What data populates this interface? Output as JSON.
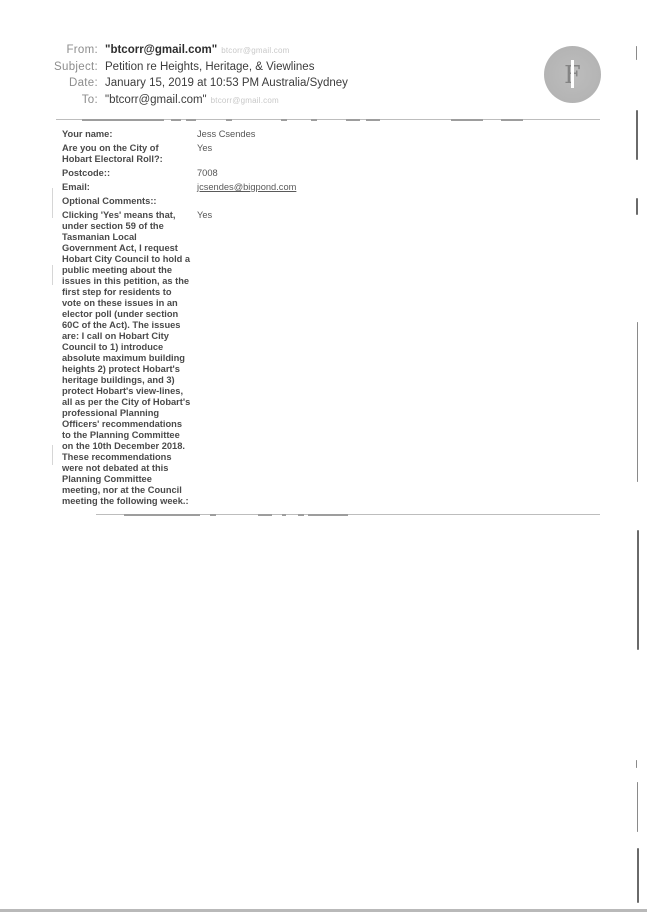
{
  "email": {
    "header": {
      "from_label": "From:",
      "from_value": "\"btcorr@gmail.com\"",
      "from_faint": "btcorr@gmail.com",
      "subject_label": "Subject:",
      "subject_value": "Petition re Heights, Heritage, & Viewlines",
      "date_label": "Date:",
      "date_value": "January 15, 2019 at 10:53 PM Australia/Sydney",
      "to_label": "To:",
      "to_value": "\"btcorr@gmail.com\"",
      "to_faint": "btcorr@gmail.com"
    },
    "avatar": {
      "icon": "sender-avatar-icon",
      "glyph": "F"
    }
  },
  "form": {
    "rows": [
      {
        "label": "Your name:",
        "value": "Jess Csendes"
      },
      {
        "label": "Are you on the City of Hobart Electoral Roll?:",
        "value": "Yes"
      },
      {
        "label": "Postcode::",
        "value": "7008"
      },
      {
        "label": "Email:",
        "value": "jcsendes@bigpond.com"
      },
      {
        "label": "Optional Comments::",
        "value": ""
      },
      {
        "label": "Clicking 'Yes' means that, under section 59 of the Tasmanian Local Government Act, I request Hobart City Council to hold a public meeting about the issues in this petition, as the first step for residents to vote on these issues in an elector poll (under section 60C of the Act). The issues are: I call on Hobart City Council to 1) introduce absolute maximum building heights 2) protect Hobart's heritage buildings, and 3) protect Hobart's view-lines, all as per the City of Hobart's professional Planning Officers' recommendations to the Planning Committee on the 10th December 2018. These recommendations were not debated at this Planning Committee meeting, nor at the Council meeting the following week.:",
        "value": "Yes"
      }
    ],
    "long_label_lines": [
      "Clicking 'Yes' means that,",
      "under section 59 of the",
      "Tasmanian Local",
      "Government Act, I request",
      "Hobart City Council to hold a",
      "public meeting about the",
      "issues in this petition, as the",
      "first step for residents to",
      "vote on these issues in an",
      "elector poll (under section",
      "60C of the Act). The issues",
      "are: I call on Hobart City",
      "Council to 1) introduce",
      "absolute maximum building",
      "heights 2) protect Hobart's",
      "heritage buildings, and 3)",
      "protect Hobart's view-lines,",
      "all as per the City of Hobart's",
      "professional Planning",
      "Officers' recommendations",
      "to the Planning Committee",
      "on the 10th December 2018.",
      "These recommendations",
      "were not debated at this",
      "Planning Committee",
      "meeting, nor at the Council",
      "meeting the following week.:"
    ]
  }
}
